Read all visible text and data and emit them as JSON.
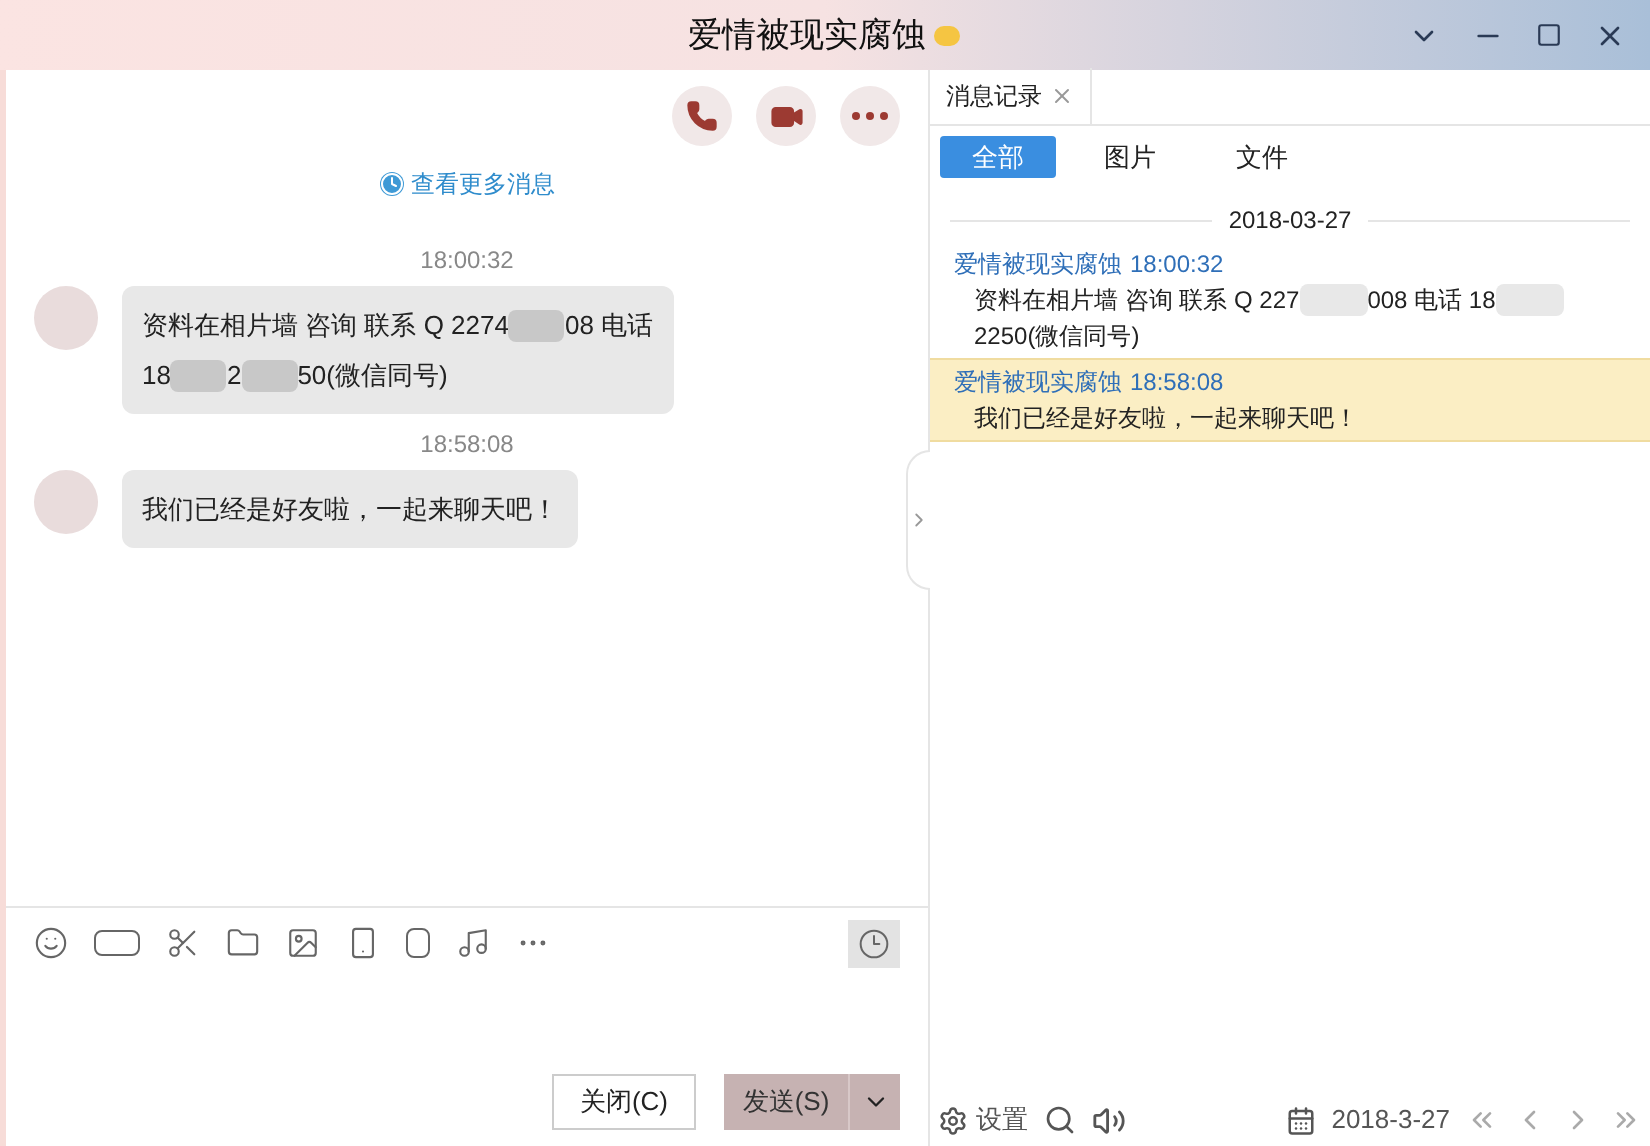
{
  "window": {
    "title": "爱情被现实腐蚀"
  },
  "chat": {
    "load_more": "查看更多消息",
    "messages": [
      {
        "time": "18:00:32",
        "segments": [
          {
            "kind": "text",
            "text": "资料在相片墙 咨询 联系 Q 2274"
          },
          {
            "kind": "redacted"
          },
          {
            "kind": "text",
            "text": "08 电话"
          },
          {
            "kind": "break"
          },
          {
            "kind": "text",
            "text": "18"
          },
          {
            "kind": "redacted"
          },
          {
            "kind": "text",
            "text": "2"
          },
          {
            "kind": "redacted"
          },
          {
            "kind": "text",
            "text": "50(微信同号)"
          }
        ]
      },
      {
        "time": "18:58:08",
        "segments": [
          {
            "kind": "text",
            "text": "我们已经是好友啦，一起来聊天吧！"
          }
        ]
      }
    ]
  },
  "composer": {
    "close_button": "关闭(C)",
    "send_button": "发送(S)"
  },
  "history": {
    "tab": {
      "label": "消息记录"
    },
    "filters": [
      {
        "label": "全部",
        "selected": true
      },
      {
        "label": "图片",
        "selected": false
      },
      {
        "label": "文件",
        "selected": false
      }
    ],
    "date": "2018-03-27",
    "entries": [
      {
        "sender": "爱情被现实腐蚀",
        "time": "18:00:32",
        "selected": false,
        "segments": [
          {
            "kind": "text",
            "text": "资料在相片墙 咨询 联系 Q 227"
          },
          {
            "kind": "redacted"
          },
          {
            "kind": "text",
            "text": "008 电话 18"
          },
          {
            "kind": "redacted"
          },
          {
            "kind": "break"
          },
          {
            "kind": "text",
            "text": "2250(微信同号)"
          }
        ]
      },
      {
        "sender": "爱情被现实腐蚀",
        "time": "18:58:08",
        "selected": true,
        "segments": [
          {
            "kind": "text",
            "text": "我们已经是好友啦，一起来聊天吧！"
          }
        ]
      }
    ],
    "settings": "设置",
    "current_date": "2018-3-27"
  }
}
